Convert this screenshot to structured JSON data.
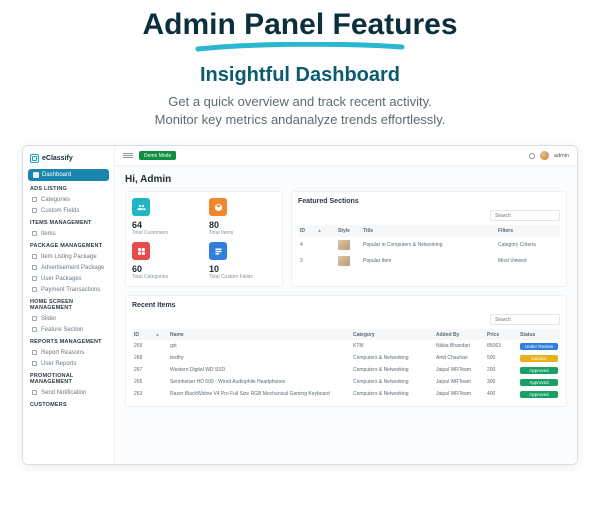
{
  "hero": {
    "title": "Admin Panel Features",
    "subtitle": "Insightful Dashboard",
    "desc1": "Get a quick overview and track recent activity.",
    "desc2": "Monitor key metrics andanalyze trends effortlessly."
  },
  "brand": "eClassify",
  "topbar": {
    "chip": "Demo Mode",
    "user": "admin"
  },
  "nav": {
    "primary": "Dashboard",
    "sec1": "Ads Listing",
    "items1": [
      "Categories",
      "Custom Fields"
    ],
    "sec2": "Items Management",
    "items2": [
      "Items"
    ],
    "sec3": "Package Management",
    "items3": [
      "Item Listing Package",
      "Advertisement Package",
      "User Packages",
      "Payment Transactions"
    ],
    "sec4": "Home Screen Management",
    "items4": [
      "Slider",
      "Feature Section"
    ],
    "sec5": "Reports Management",
    "items5": [
      "Report Reasons",
      "User Reports"
    ],
    "sec6": "Promotional Management",
    "items6": [
      "Send Notification"
    ],
    "sec7": "Customers"
  },
  "greeting": "Hi, Admin",
  "stats": [
    {
      "n": "64",
      "l": "Total Customers"
    },
    {
      "n": "80",
      "l": "Total Items"
    },
    {
      "n": "60",
      "l": "Total Categories"
    },
    {
      "n": "10",
      "l": "Total Custom Fields"
    }
  ],
  "featured": {
    "title": "Featured Sections",
    "search_ph": "Search",
    "head": {
      "id": "ID",
      "style": "Style",
      "title": "Title",
      "filters": "Filters"
    },
    "rows": [
      {
        "id": "4",
        "title": "Popular in Computers & Networking",
        "filters": "Category Criteria"
      },
      {
        "id": "3",
        "title": "Popular Item",
        "filters": "Most Viewed"
      }
    ]
  },
  "recent": {
    "title": "Recent Items",
    "head": {
      "id": "ID",
      "name": "Name",
      "category": "Category",
      "added": "Added By",
      "price": "Price",
      "status": "Status"
    },
    "rows": [
      {
        "id": "269",
        "name": "gst",
        "category": "KTM",
        "added": "Nikita Bhandari",
        "price": "85063",
        "status": "Under Review",
        "cls": "p-blue"
      },
      {
        "id": "268",
        "name": "testfry",
        "category": "Computers & Networking",
        "added": "Amit Chauhan",
        "price": "500",
        "status": "Inactive",
        "cls": "p-yellow"
      },
      {
        "id": "267",
        "name": "Western Digital WD SSD",
        "category": "Computers & Networking",
        "added": "Jaipal WRTeam",
        "price": "200",
        "status": "Approved",
        "cls": "p-green"
      },
      {
        "id": "265",
        "name": "Sennheiser HD 600 - Wired Audiophile Headphones",
        "category": "Computers & Networking",
        "added": "Jaipal WRTeam",
        "price": "300",
        "status": "Approved",
        "cls": "p-green"
      },
      {
        "id": "263",
        "name": "Razer BlackWidow V4 Pro Full Size RGB Mechanical Gaming Keyboard",
        "category": "Computers & Networking",
        "added": "Jaipal WRTeam",
        "price": "400",
        "status": "Approved",
        "cls": "p-green"
      }
    ]
  }
}
